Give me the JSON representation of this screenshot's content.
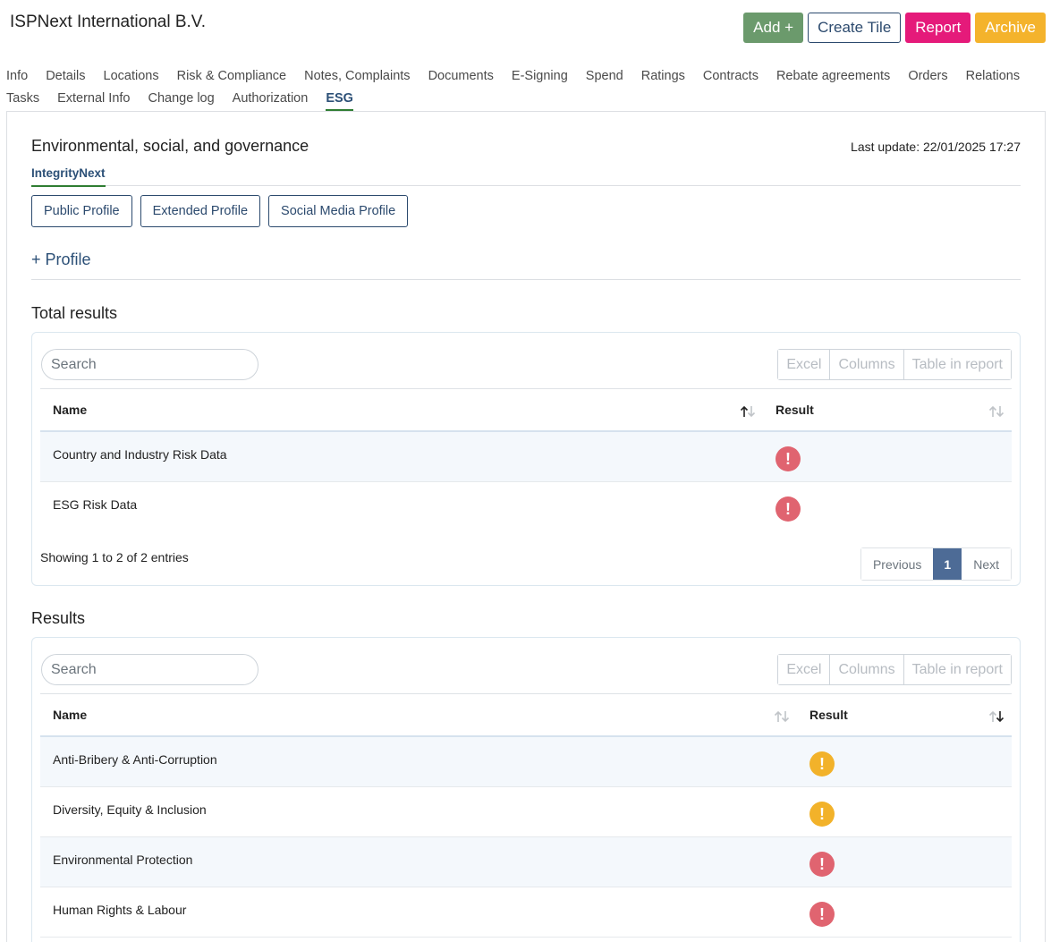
{
  "header": {
    "company_name": "ISPNext International B.V.",
    "actions": {
      "add": "Add +",
      "create_tile": "Create Tile",
      "report": "Report",
      "archive": "Archive"
    }
  },
  "nav": {
    "row1": [
      "Info",
      "Details",
      "Locations",
      "Risk & Compliance",
      "Notes, Complaints",
      "Documents",
      "E-Signing",
      "Spend",
      "Ratings",
      "Contracts",
      "Rebate agreements",
      "Orders",
      "Relations"
    ],
    "row2": [
      "Tasks",
      "External Info",
      "Change log",
      "Authorization",
      "ESG"
    ],
    "active": "ESG"
  },
  "esg": {
    "title": "Environmental, social, and governance",
    "last_update": "Last update: 22/01/2025 17:27",
    "subtab": "IntegrityNext",
    "profile_buttons": {
      "public": "Public Profile",
      "extended": "Extended Profile",
      "social": "Social Media Profile"
    },
    "add_profile": "+ Profile"
  },
  "total_results": {
    "title": "Total results",
    "search_placeholder": "Search",
    "tools": {
      "excel": "Excel",
      "columns": "Columns",
      "table_in_report": "Table in report"
    },
    "columns": {
      "name": "Name",
      "result": "Result"
    },
    "rows": [
      {
        "name": "Country and Industry Risk Data",
        "status": "red",
        "icon": "exclamation-red-icon"
      },
      {
        "name": "ESG Risk Data",
        "status": "red",
        "icon": "exclamation-red-icon"
      }
    ],
    "showing": "Showing 1 to 2 of 2 entries",
    "pager": {
      "previous": "Previous",
      "page": "1",
      "next": "Next"
    }
  },
  "results": {
    "title": "Results",
    "search_placeholder": "Search",
    "tools": {
      "excel": "Excel",
      "columns": "Columns",
      "table_in_report": "Table in report"
    },
    "columns": {
      "name": "Name",
      "result": "Result"
    },
    "rows": [
      {
        "name": "Anti-Bribery & Anti-Corruption",
        "status": "amber",
        "icon": "exclamation-amber-icon"
      },
      {
        "name": "Diversity, Equity & Inclusion",
        "status": "amber",
        "icon": "exclamation-amber-icon"
      },
      {
        "name": "Environmental Protection",
        "status": "red",
        "icon": "exclamation-red-icon"
      },
      {
        "name": "Human Rights & Labour",
        "status": "red",
        "icon": "exclamation-red-icon"
      }
    ]
  },
  "colors": {
    "primary": "#2c4a6e",
    "active_tab_underline": "#2f7d32",
    "add": "#6b9a6c",
    "report": "#e51a7a",
    "archive": "#f4b32c",
    "status_red": "#e06470",
    "status_amber": "#f2b22a"
  }
}
